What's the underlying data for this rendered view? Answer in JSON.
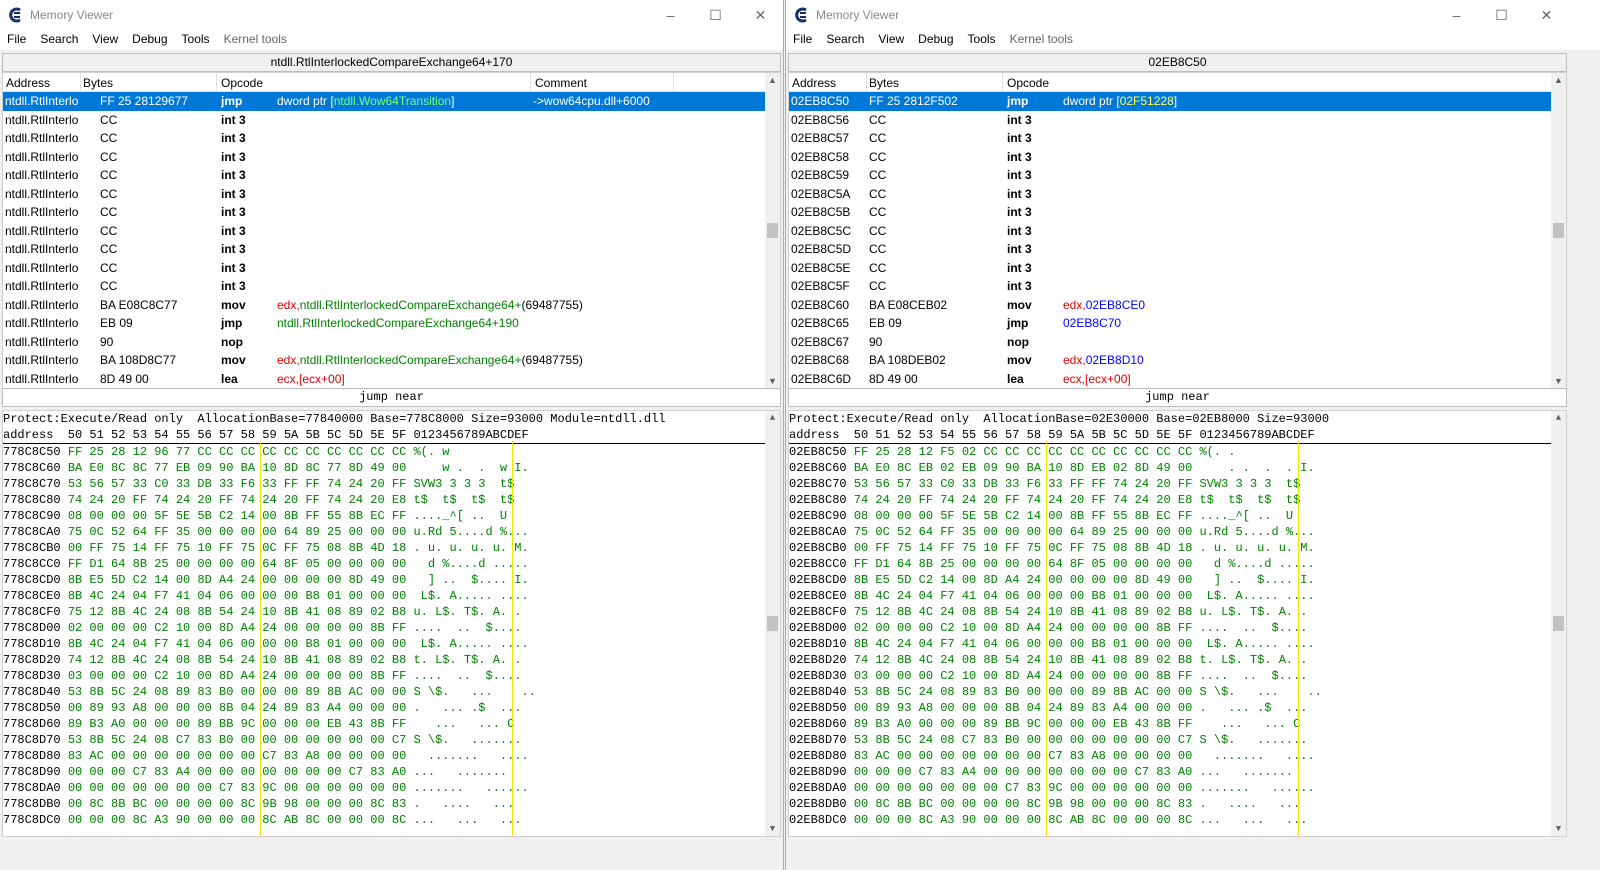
{
  "left": {
    "title": "Memory Viewer",
    "menu": [
      "File",
      "Search",
      "View",
      "Debug",
      "Tools",
      "Kernel tools"
    ],
    "address_bar": "ntdll.RtlInterlockedCompareExchange64+170",
    "columns": [
      "Address",
      "Bytes",
      "Opcode",
      "Comment"
    ],
    "rows": [
      {
        "addr": "ntdll.RtlInterlo",
        "bytes": "FF 25 28129677",
        "op": "jmp",
        "arg": "dword ptr [",
        "arg2": "ntdll.Wow64Transition",
        "arg3": "]",
        "comment": "->wow64cpu.dll+6000",
        "sel": true
      },
      {
        "addr": "ntdll.RtlInterlo",
        "bytes": "CC",
        "op": "int 3"
      },
      {
        "addr": "ntdll.RtlInterlo",
        "bytes": "CC",
        "op": "int 3"
      },
      {
        "addr": "ntdll.RtlInterlo",
        "bytes": "CC",
        "op": "int 3"
      },
      {
        "addr": "ntdll.RtlInterlo",
        "bytes": "CC",
        "op": "int 3"
      },
      {
        "addr": "ntdll.RtlInterlo",
        "bytes": "CC",
        "op": "int 3"
      },
      {
        "addr": "ntdll.RtlInterlo",
        "bytes": "CC",
        "op": "int 3"
      },
      {
        "addr": "ntdll.RtlInterlo",
        "bytes": "CC",
        "op": "int 3"
      },
      {
        "addr": "ntdll.RtlInterlo",
        "bytes": "CC",
        "op": "int 3"
      },
      {
        "addr": "ntdll.RtlInterlo",
        "bytes": "CC",
        "op": "int 3"
      },
      {
        "addr": "ntdll.RtlInterlo",
        "bytes": "CC",
        "op": "int 3"
      },
      {
        "addr": "ntdll.RtlInterlo",
        "bytes": "BA E08C8C77",
        "op": "mov",
        "reg": "edx,",
        "arg": "ntdll.RtlInterlockedCompareExchange64+",
        "arg3": "(69487755)"
      },
      {
        "addr": "ntdll.RtlInterlo",
        "bytes": "EB 09",
        "op": "jmp",
        "arg": "ntdll.RtlInterlockedCompareExchange64+190"
      },
      {
        "addr": "ntdll.RtlInterlo",
        "bytes": "90",
        "op": "nop"
      },
      {
        "addr": "ntdll.RtlInterlo",
        "bytes": "BA 108D8C77",
        "op": "mov",
        "reg": "edx,",
        "arg": "ntdll.RtlInterlockedCompareExchange64+",
        "arg3": "(69487755)"
      },
      {
        "addr": "ntdll.RtlInterlo",
        "bytes": "8D 49 00",
        "op": "lea",
        "reg": "ecx,",
        "lea": "[ecx+00]"
      }
    ],
    "status": "jump near",
    "hex_info": "Protect:Execute/Read only  AllocationBase=77840000 Base=778C8000 Size=93000 Module=ntdll.dll",
    "hex_header": "address  50 51 52 53 54 55 56 57 58 59 5A 5B 5C 5D 5E 5F 0123456789ABCDEF",
    "hex_lines": [
      [
        "778C8C50",
        "FF 25 28 12 96 77 CC CC CC CC CC CC CC CC CC CC",
        "%(. w          "
      ],
      [
        "778C8C60",
        "BA E0 8C 8C 77 EB 09 90 BA 10 8D 8C 77 8D 49 00",
        "    w .  .  w I."
      ],
      [
        "778C8C70",
        "53 56 57 33 C0 33 DB 33 F6 33 FF FF 74 24 20 FF",
        "SVW3 3 3 3  t$ "
      ],
      [
        "778C8C80",
        "74 24 20 FF 74 24 20 FF 74 24 20 FF 74 24 20 E8",
        "t$  t$  t$  t$ "
      ],
      [
        "778C8C90",
        "08 00 00 00 5F 5E 5B C2 14 00 8B FF 55 8B EC FF",
        "...._^[ ..  U  "
      ],
      [
        "778C8CA0",
        "75 0C 52 64 FF 35 00 00 00 00 64 89 25 00 00 00",
        "u.Rd 5....d %..."
      ],
      [
        "778C8CB0",
        "00 FF 75 14 FF 75 10 FF 75 0C FF 75 08 8B 4D 18",
        ". u. u. u. u. M."
      ],
      [
        "778C8CC0",
        "FF D1 64 8B 25 00 00 00 00 64 8F 05 00 00 00 00",
        "  d %....d ....."
      ],
      [
        "778C8CD0",
        "8B E5 5D C2 14 00 8D A4 24 00 00 00 00 8D 49 00",
        "  ] ..  $.... I."
      ],
      [
        "778C8CE0",
        "8B 4C 24 04 F7 41 04 06 00 00 00 B8 01 00 00 00",
        " L$. A..... ...."
      ],
      [
        "778C8CF0",
        "75 12 8B 4C 24 08 8B 54 24 10 8B 41 08 89 02 B8",
        "u. L$. T$. A. . "
      ],
      [
        "778C8D00",
        "02 00 00 00 C2 10 00 8D A4 24 00 00 00 00 8B FF",
        "....  ..  $....  "
      ],
      [
        "778C8D10",
        "8B 4C 24 04 F7 41 04 06 00 00 00 B8 01 00 00 00",
        " L$. A..... ...."
      ],
      [
        "778C8D20",
        "74 12 8B 4C 24 08 8B 54 24 10 8B 41 08 89 02 B8",
        "t. L$. T$. A. . "
      ],
      [
        "778C8D30",
        "03 00 00 00 C2 10 00 8D A4 24 00 00 00 00 8B FF",
        "....  ..  $....  "
      ],
      [
        "778C8D40",
        "53 8B 5C 24 08 89 83 B0 00 00 00 89 8B AC 00 00",
        "S \\$.   ...    .."
      ],
      [
        "778C8D50",
        "00 89 93 A8 00 00 00 8B 04 24 89 83 A4 00 00 00",
        ".   ... .$  ... "
      ],
      [
        "778C8D60",
        "89 B3 A0 00 00 00 89 BB 9C 00 00 00 EB 43 8B FF",
        "   ...   ... C  "
      ],
      [
        "778C8D70",
        "53 8B 5C 24 08 C7 83 B0 00 00 00 00 00 00 00 C7",
        "S \\$.   ....... "
      ],
      [
        "778C8D80",
        "83 AC 00 00 00 00 00 00 00 C7 83 A8 00 00 00 00",
        "  .......   ...."
      ],
      [
        "778C8D90",
        "00 00 00 C7 83 A4 00 00 00 00 00 00 00 C7 83 A0",
        "...   .......   "
      ],
      [
        "778C8DA0",
        "00 00 00 00 00 00 00 C7 83 9C 00 00 00 00 00 00",
        ".......   ......"
      ],
      [
        "778C8DB0",
        "00 8C 8B BC 00 00 00 00 8C 9B 98 00 00 00 8C 83",
        ".   ....   ...  "
      ],
      [
        "778C8DC0",
        "00 00 00 8C A3 90 00 00 00 8C AB 8C 00 00 00 8C",
        "...   ...   ... "
      ]
    ]
  },
  "right": {
    "title": "Memory Viewer",
    "menu": [
      "File",
      "Search",
      "View",
      "Debug",
      "Tools",
      "Kernel tools"
    ],
    "address_bar": "02EB8C50",
    "columns": [
      "Address",
      "Bytes",
      "Opcode"
    ],
    "rows": [
      {
        "addr": "02EB8C50",
        "bytes": "FF 25 2812F502",
        "op": "jmp",
        "arg": "dword ptr [",
        "arg2": "02F51228",
        "arg3": "]",
        "sel": true
      },
      {
        "addr": "02EB8C56",
        "bytes": "CC",
        "op": "int 3"
      },
      {
        "addr": "02EB8C57",
        "bytes": "CC",
        "op": "int 3"
      },
      {
        "addr": "02EB8C58",
        "bytes": "CC",
        "op": "int 3"
      },
      {
        "addr": "02EB8C59",
        "bytes": "CC",
        "op": "int 3"
      },
      {
        "addr": "02EB8C5A",
        "bytes": "CC",
        "op": "int 3"
      },
      {
        "addr": "02EB8C5B",
        "bytes": "CC",
        "op": "int 3"
      },
      {
        "addr": "02EB8C5C",
        "bytes": "CC",
        "op": "int 3"
      },
      {
        "addr": "02EB8C5D",
        "bytes": "CC",
        "op": "int 3"
      },
      {
        "addr": "02EB8C5E",
        "bytes": "CC",
        "op": "int 3"
      },
      {
        "addr": "02EB8C5F",
        "bytes": "CC",
        "op": "int 3"
      },
      {
        "addr": "02EB8C60",
        "bytes": "BA E08CEB02",
        "op": "mov",
        "reg": "edx,",
        "argb": "02EB8CE0"
      },
      {
        "addr": "02EB8C65",
        "bytes": "EB 09",
        "op": "jmp",
        "argb": "02EB8C70"
      },
      {
        "addr": "02EB8C67",
        "bytes": "90",
        "op": "nop"
      },
      {
        "addr": "02EB8C68",
        "bytes": "BA 108DEB02",
        "op": "mov",
        "reg": "edx,",
        "argb": "02EB8D10"
      },
      {
        "addr": "02EB8C6D",
        "bytes": "8D 49 00",
        "op": "lea",
        "reg": "ecx,",
        "lea": "[ecx+00]"
      }
    ],
    "status": "jump near",
    "hex_info": "Protect:Execute/Read only  AllocationBase=02E30000 Base=02EB8000 Size=93000",
    "hex_header": "address  50 51 52 53 54 55 56 57 58 59 5A 5B 5C 5D 5E 5F 0123456789ABCDEF",
    "hex_lines": [
      [
        "02EB8C50",
        "FF 25 28 12 F5 02 CC CC CC CC CC CC CC CC CC CC",
        "%(. .          "
      ],
      [
        "02EB8C60",
        "BA E0 8C EB 02 EB 09 90 BA 10 8D EB 02 8D 49 00",
        "    . .  .  . I."
      ],
      [
        "02EB8C70",
        "53 56 57 33 C0 33 DB 33 F6 33 FF FF 74 24 20 FF",
        "SVW3 3 3 3  t$ "
      ],
      [
        "02EB8C80",
        "74 24 20 FF 74 24 20 FF 74 24 20 FF 74 24 20 E8",
        "t$  t$  t$  t$ "
      ],
      [
        "02EB8C90",
        "08 00 00 00 5F 5E 5B C2 14 00 8B FF 55 8B EC FF",
        "...._^[ ..  U  "
      ],
      [
        "02EB8CA0",
        "75 0C 52 64 FF 35 00 00 00 00 64 89 25 00 00 00",
        "u.Rd 5....d %..."
      ],
      [
        "02EB8CB0",
        "00 FF 75 14 FF 75 10 FF 75 0C FF 75 08 8B 4D 18",
        ". u. u. u. u. M."
      ],
      [
        "02EB8CC0",
        "FF D1 64 8B 25 00 00 00 00 64 8F 05 00 00 00 00",
        "  d %....d ....."
      ],
      [
        "02EB8CD0",
        "8B E5 5D C2 14 00 8D A4 24 00 00 00 00 8D 49 00",
        "  ] ..  $.... I."
      ],
      [
        "02EB8CE0",
        "8B 4C 24 04 F7 41 04 06 00 00 00 B8 01 00 00 00",
        " L$. A..... ...."
      ],
      [
        "02EB8CF0",
        "75 12 8B 4C 24 08 8B 54 24 10 8B 41 08 89 02 B8",
        "u. L$. T$. A. . "
      ],
      [
        "02EB8D00",
        "02 00 00 00 C2 10 00 8D A4 24 00 00 00 00 8B FF",
        "....  ..  $....  "
      ],
      [
        "02EB8D10",
        "8B 4C 24 04 F7 41 04 06 00 00 00 B8 01 00 00 00",
        " L$. A..... ...."
      ],
      [
        "02EB8D20",
        "74 12 8B 4C 24 08 8B 54 24 10 8B 41 08 89 02 B8",
        "t. L$. T$. A. . "
      ],
      [
        "02EB8D30",
        "03 00 00 00 C2 10 00 8D A4 24 00 00 00 00 8B FF",
        "....  ..  $....  "
      ],
      [
        "02EB8D40",
        "53 8B 5C 24 08 89 83 B0 00 00 00 89 8B AC 00 00",
        "S \\$.   ...    .."
      ],
      [
        "02EB8D50",
        "00 89 93 A8 00 00 00 8B 04 24 89 83 A4 00 00 00",
        ".   ... .$  ... "
      ],
      [
        "02EB8D60",
        "89 B3 A0 00 00 00 89 BB 9C 00 00 00 EB 43 8B FF",
        "   ...   ... C  "
      ],
      [
        "02EB8D70",
        "53 8B 5C 24 08 C7 83 B0 00 00 00 00 00 00 00 C7",
        "S \\$.   ....... "
      ],
      [
        "02EB8D80",
        "83 AC 00 00 00 00 00 00 00 C7 83 A8 00 00 00 00",
        "  .......   ...."
      ],
      [
        "02EB8D90",
        "00 00 00 C7 83 A4 00 00 00 00 00 00 00 C7 83 A0",
        "...   .......   "
      ],
      [
        "02EB8DA0",
        "00 00 00 00 00 00 00 C7 83 9C 00 00 00 00 00 00",
        ".......   ......"
      ],
      [
        "02EB8DB0",
        "00 8C 8B BC 00 00 00 00 8C 9B 98 00 00 00 8C 83",
        ".   ....   ...  "
      ],
      [
        "02EB8DC0",
        "00 00 00 8C A3 90 00 00 00 8C AB 8C 00 00 00 8C",
        "...   ...   ... "
      ]
    ]
  },
  "colors": {
    "selection": "#0078d7",
    "register": "#e00000",
    "symbol": "#008000",
    "address": "#0000ff",
    "hex": "#008000",
    "column_guide": "#e8e800"
  }
}
